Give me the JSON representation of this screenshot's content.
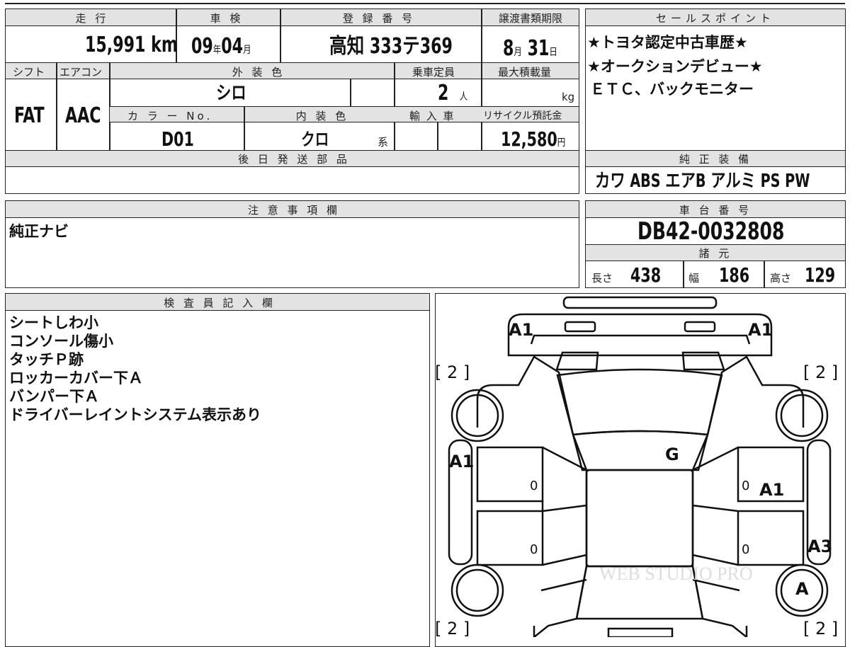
{
  "mileage": {
    "label": "走 行",
    "value": "15,991",
    "unit": "km"
  },
  "inspection": {
    "label": "車 検",
    "year": "09",
    "year_unit": "年",
    "month": "04",
    "month_unit": "月"
  },
  "registration": {
    "label": "登 録 番 号",
    "value": "高知 333テ369"
  },
  "transfer_deadline": {
    "label": "譲渡書類期限",
    "month": "8",
    "month_unit": "月",
    "day": "31",
    "day_unit": "日"
  },
  "shift": {
    "label": "シフト",
    "value": "FAT"
  },
  "aircon": {
    "label": "エアコン",
    "value": "AAC"
  },
  "exterior_color": {
    "label": "外 装 色",
    "value": "シロ"
  },
  "capacity": {
    "label": "乗車定員",
    "value": "2",
    "unit": "人"
  },
  "max_load": {
    "label": "最大積載量",
    "value": "",
    "unit": "kg"
  },
  "color_no": {
    "label": "カ ラ ー No.",
    "value": "D01"
  },
  "interior_color": {
    "label": "内 装 色",
    "value": "クロ",
    "suffix": "系"
  },
  "import_car": {
    "label": "輸 入 車"
  },
  "recycle_fee": {
    "label": "リサイクル預託金",
    "value": "12,580",
    "unit": "円"
  },
  "later_parts": {
    "label": "後 日 発 送 部 品",
    "value": ""
  },
  "sales_points": {
    "label": "セールスポイント",
    "lines": [
      "★トヨタ認定中古車歴★",
      "★オークションデビュー★",
      "ＥＴＣ、バックモニター"
    ]
  },
  "genuine_equipment": {
    "label": "純 正 装 備",
    "value": "カワ  ABS  エアB  アルミ  PS  PW"
  },
  "caution": {
    "label": "注 意 事 項 欄",
    "value": "純正ナビ"
  },
  "chassis_number": {
    "label": "車 台 番 号",
    "value": "DB42-0032808"
  },
  "specs": {
    "label": "諸 元",
    "length_label": "長さ",
    "length": "438",
    "width_label": "幅",
    "width": "186",
    "height_label": "高さ",
    "height": "129"
  },
  "inspector_notes": {
    "label": "検 査 員 記 入 欄",
    "lines": [
      "シートしわ小",
      "コンソール傷小",
      "タッチＰ跡",
      "ロッカーカバー下Ａ",
      "バンパー下Ａ",
      "ドライバーレイントシステム表示あり"
    ]
  },
  "diagram": {
    "marks": {
      "front_left": "A1",
      "front_right": "A1",
      "tire_fl": "[ 2 ]",
      "tire_fr": "[ 2 ]",
      "tire_rl": "[ 2 ]",
      "tire_rr": "[ 2 ]",
      "left_front_fender": "A1",
      "windshield": "G",
      "door_fl_val": "0",
      "door_fr_val": "0",
      "door_rl_val": "0",
      "door_rr_val": "0",
      "right_front_door": "A1",
      "right_rear_fender": "A3",
      "right_rear_wheel": "A"
    },
    "watermark": "WEB STUDIO PRO"
  }
}
